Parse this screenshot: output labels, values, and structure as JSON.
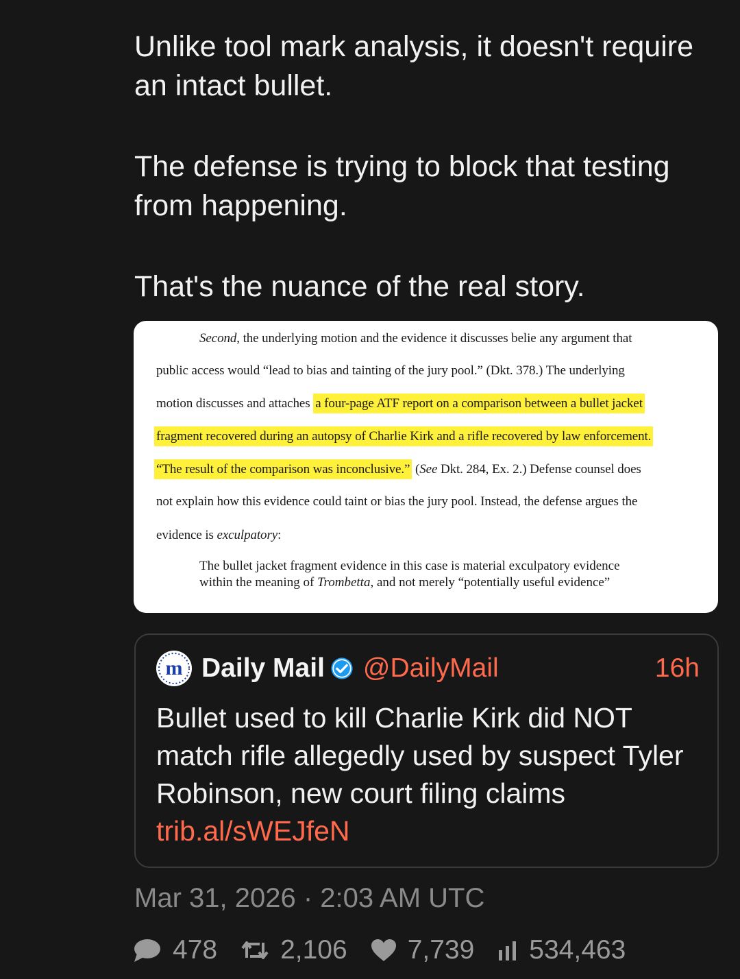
{
  "post": {
    "paragraphs": [
      "Unlike tool mark analysis, it doesn't require\nan intact bullet.",
      "The defense is trying to block that testing\nfrom happening.",
      "That's the nuance of the real story."
    ]
  },
  "document": {
    "line1_italic": "Second",
    "line1_rest": ", the underlying motion and the evidence it discusses belie any argument that",
    "line2": "public access would “lead to bias and tainting of the jury pool.” (Dkt. 378.) The underlying",
    "line3_plain": "motion discusses and attaches ",
    "line3_highlight": "a four-page ATF report on a comparison between a bullet jacket",
    "line4_highlight": "fragment recovered during an autopsy of Charlie Kirk and a rifle recovered by law enforcement.",
    "line5_highlight": "“The result of the comparison was inconclusive.”",
    "line5_paren_open": " (",
    "line5_see": "See",
    "line5_rest": " Dkt. 284, Ex. 2.) Defense counsel does",
    "line6": "not explain how this evidence could taint or bias the jury pool. Instead, the defense argues the",
    "line7_plain": "evidence is ",
    "line7_italic": "exculpatory",
    "line7_colon": ":",
    "quote_line1": "The bullet jacket fragment evidence in this case is material exculpatory evidence",
    "quote_line2_a": "within the meaning of ",
    "quote_line2_italic": "Trombetta",
    "quote_line2_b": ", and not merely “potentially useful evidence”"
  },
  "quoted_post": {
    "avatar_letter": "m",
    "name": "Daily Mail",
    "handle": "@DailyMail",
    "time": "16h",
    "text": "Bullet used to kill Charlie Kirk did NOT match rifle allegedly used by suspect Tyler Robinson, new court filing claims",
    "link": "trib.al/sWEJfeN",
    "colors": {
      "accent": "#ff6a4d",
      "verified": "#1d9bf0",
      "avatar_blue": "#1a3fa8"
    }
  },
  "timestamp": "Mar 31, 2026 · 2:03 AM UTC",
  "stats": {
    "replies": "478",
    "retweets": "2,106",
    "likes": "7,739",
    "views": "534,463"
  }
}
